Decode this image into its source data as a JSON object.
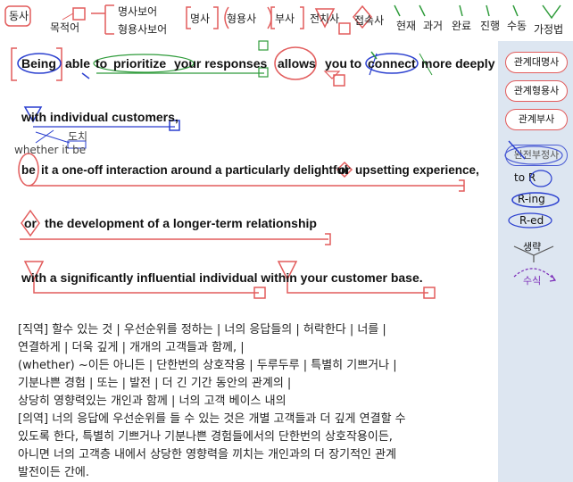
{
  "legend": {
    "verb": "동사",
    "object": "목적어",
    "noun_complement": "명사보어",
    "adj_complement": "형용사보어",
    "noun": "명사",
    "adjective": "형용사",
    "adverb": "부사",
    "preposition": "전치사",
    "conjunction": "접속사",
    "present": "현재",
    "past": "과거",
    "perfect": "완료",
    "progressive": "진행",
    "passive": "수동",
    "subjunctive": "가정법"
  },
  "sidebar": {
    "rel_pronoun": "관계대명사",
    "rel_adjective": "관계형용사",
    "rel_adverb": "관계부사",
    "participle_clause": "완전부정사",
    "to_r": "to R",
    "r_ing": "R-ing",
    "r_ed": "R-ed",
    "omission": "생략",
    "modifier": "수식"
  },
  "sentence": {
    "w_being": "Being",
    "w_able": "able",
    "w_to1": "to",
    "w_prioritize": "prioritize",
    "w_your": "your responses",
    "w_allows": "allows",
    "w_you": "you",
    "w_to2": "to",
    "w_connect": "connect",
    "w_more": "more deeply",
    "line2": "with individual customers,",
    "inversion_label": "도치",
    "inserted": "whether it be",
    "l3_be": "be",
    "l3_rest": "it a one-off interaction around a particularly delightful",
    "l3_or": "or",
    "l3_end": "upsetting experience,",
    "l4_or": "or",
    "l4_rest": "the development of a longer-term relationship",
    "line5": "with a significantly influential individual within your customer base."
  },
  "translation": {
    "literal_1": "[직역] 할수 있는 것 | 우선순위를 정하는 | 너의 응답들의 | 허락한다 | 너를 |",
    "literal_2": " 연결하게 | 더욱 깊게 | 개개의 고객들과 함께, |",
    "literal_3": " (whether) ~이든 아니든 | 단한번의 상호작용 | 두루두루 | 특별히 기쁘거나 |",
    "literal_4": " 기분나쁜 경험 | 또는 | 발전 | 더 긴 기간 동안의 관계의 |",
    "literal_5": " 상당히 영향력있는 개인과 함께 | 너의 고객 베이스 내의",
    "free_1": "[의역] 너의 응답에 우선순위를 들 수 있는 것은 개별 고객들과 더 깊게 연결할 수",
    "free_2": " 있도록 한다, 특별히 기쁘거나 기분나쁜 경험들에서의 단한번의 상호작용이든,",
    "free_3": " 아니면 너의 고객층 내에서 상당한 영향력을 끼치는 개인과의 더 장기적인 관계",
    "free_4": " 발전이든 간에."
  },
  "colors": {
    "red": "#e25c5c",
    "blue": "#2a3fcf",
    "green": "#2e9b3a",
    "purple": "#7a2bb8",
    "panel": "#dde6f1"
  }
}
